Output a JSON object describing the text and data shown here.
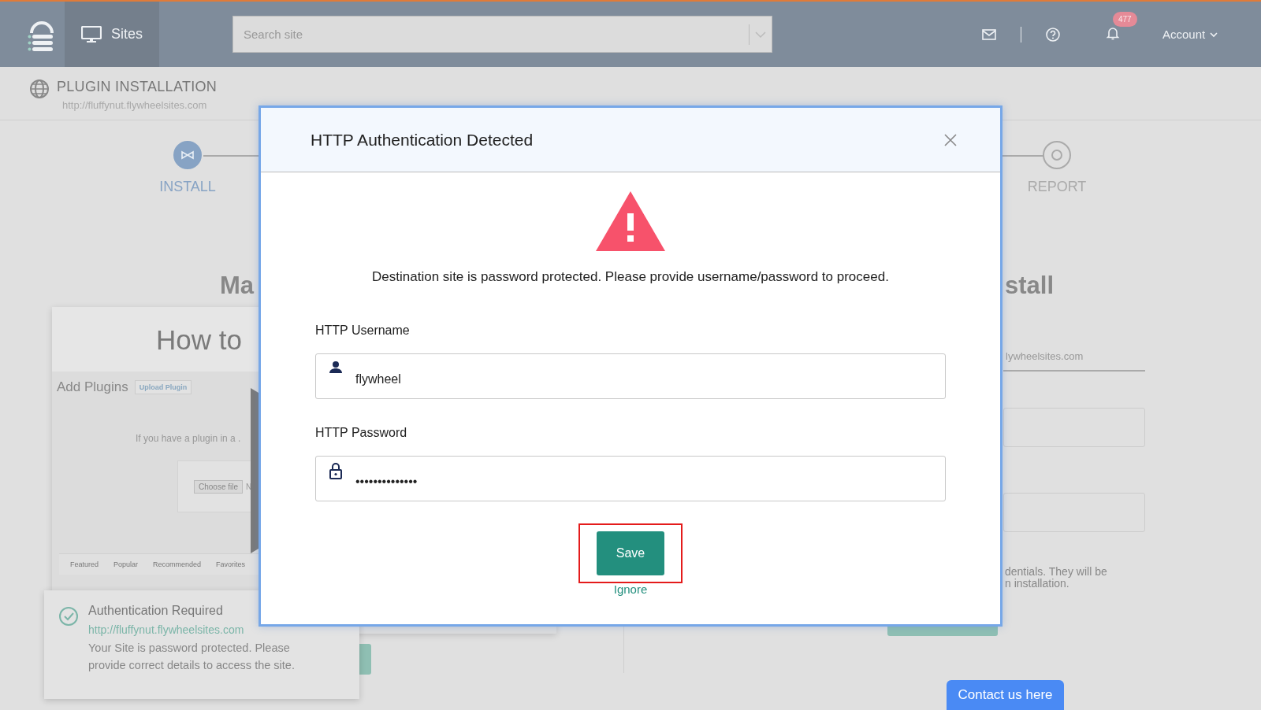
{
  "topbar": {
    "nav_item": {
      "label": "Sites",
      "selected": true
    },
    "search": {
      "placeholder": "Search site"
    },
    "notification_count": "477",
    "account": {
      "label": "Account"
    }
  },
  "page_header": {
    "title": "PLUGIN INSTALLATION",
    "url": "http://fluffynut.flywheelsites.com"
  },
  "steps": [
    {
      "label": "INSTALL",
      "selected": true
    },
    {
      "label": "REPORT",
      "selected": false
    }
  ],
  "left_panel": {
    "heading": "Ma",
    "video": {
      "title": "How to",
      "screen": {
        "title": "Add Plugins",
        "upload_button": "Upload Plugin",
        "hint": "If you have a plugin in a .",
        "choose_button": "Choose file",
        "file_status": "N",
        "tabs": [
          "Featured",
          "Popular",
          "Recommended",
          "Favorites"
        ]
      }
    }
  },
  "right_panel": {
    "heading": "stall",
    "url_value": "lywheelsites.com",
    "note_lines": [
      "dentials. They will be",
      "n installation."
    ]
  },
  "toast": {
    "title": "Authentication Required",
    "link": "http://fluffynut.flywheelsites.com",
    "message": "Your Site is password protected. Please provide correct details to access the site."
  },
  "dialog": {
    "title": "HTTP Authentication Detected",
    "message": "Destination site is password protected. Please provide username/password to proceed.",
    "fields": [
      {
        "label": "HTTP Username",
        "kind": "user",
        "value": "flywheel"
      },
      {
        "label": "HTTP Password",
        "kind": "password",
        "value": "••••••••••••••"
      }
    ],
    "save_button": {
      "label": "Save",
      "highlighted": true
    },
    "ignore_link": "Ignore"
  },
  "contact_button": "Contact us here"
}
